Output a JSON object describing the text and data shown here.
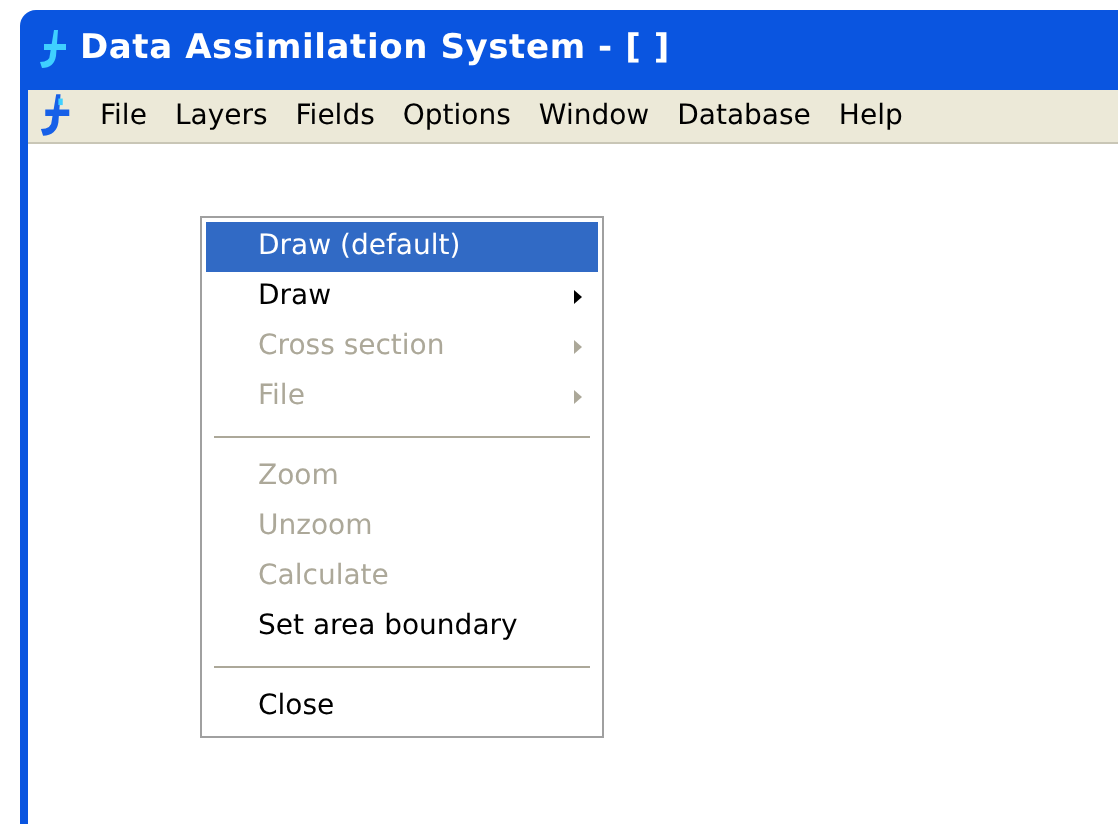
{
  "window": {
    "title": "Data Assimilation System - [ ]"
  },
  "menubar": [
    {
      "label": "File"
    },
    {
      "label": "Layers"
    },
    {
      "label": "Fields"
    },
    {
      "label": "Options"
    },
    {
      "label": "Window"
    },
    {
      "label": "Database"
    },
    {
      "label": "Help"
    }
  ],
  "context_menu": [
    {
      "kind": "item",
      "label": "Draw (default)",
      "selected": true,
      "disabled": false,
      "submenu": false
    },
    {
      "kind": "item",
      "label": "Draw",
      "selected": false,
      "disabled": false,
      "submenu": true
    },
    {
      "kind": "item",
      "label": "Cross section",
      "selected": false,
      "disabled": true,
      "submenu": true
    },
    {
      "kind": "item",
      "label": "File",
      "selected": false,
      "disabled": true,
      "submenu": true
    },
    {
      "kind": "separator"
    },
    {
      "kind": "item",
      "label": "Zoom",
      "selected": false,
      "disabled": true,
      "submenu": false
    },
    {
      "kind": "item",
      "label": "Unzoom",
      "selected": false,
      "disabled": true,
      "submenu": false
    },
    {
      "kind": "item",
      "label": "Calculate",
      "selected": false,
      "disabled": true,
      "submenu": false
    },
    {
      "kind": "item",
      "label": "Set area boundary",
      "selected": false,
      "disabled": false,
      "submenu": false
    },
    {
      "kind": "separator"
    },
    {
      "kind": "item",
      "label": "Close",
      "selected": false,
      "disabled": false,
      "submenu": false
    }
  ]
}
